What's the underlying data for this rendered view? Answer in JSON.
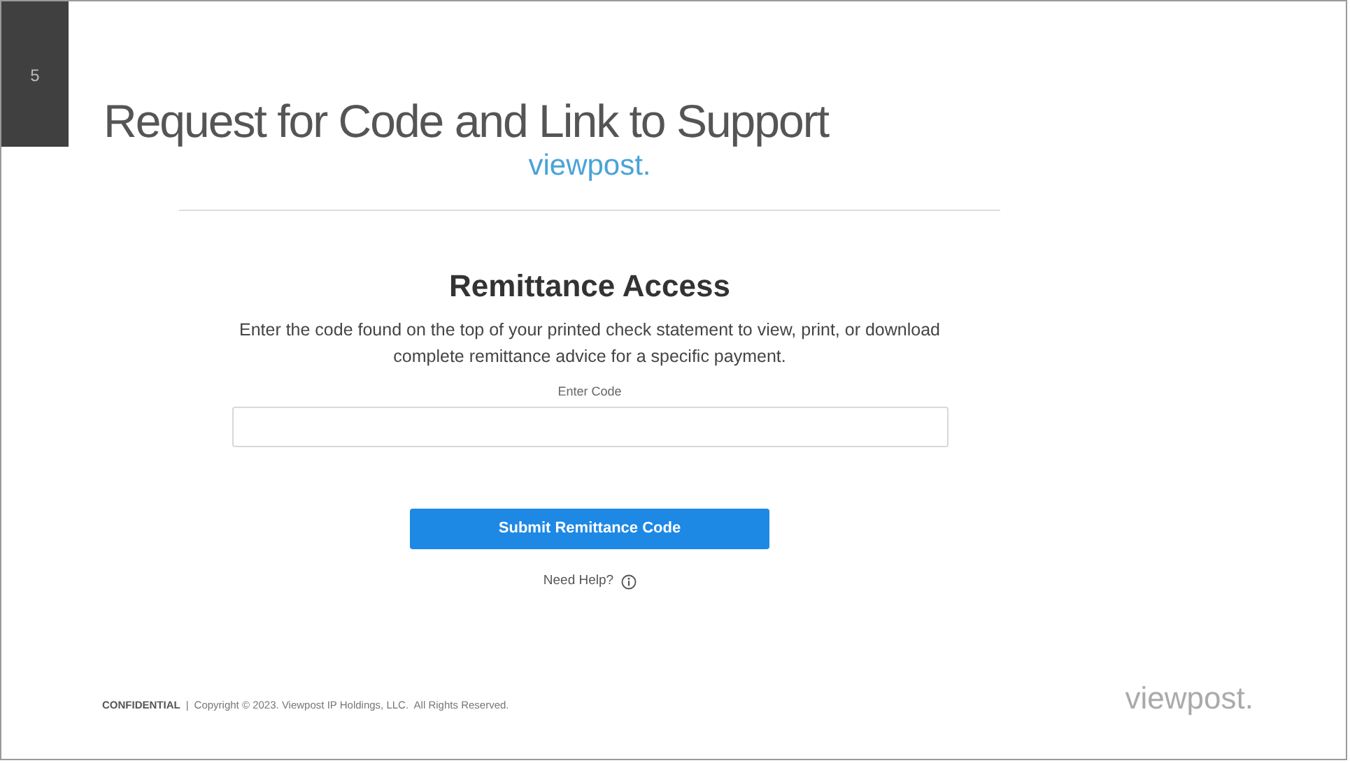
{
  "slide": {
    "number": "5",
    "title": "Request for Code and Link to Support"
  },
  "web_page": {
    "logo": "viewpost.",
    "heading": "Remittance Access",
    "description": "Enter the code found on the top of your printed check statement to view, print, or download complete remittance advice for a specific payment.",
    "code_field": {
      "label": "Enter Code"
    },
    "submit_button": "Submit Remittance Code",
    "help_link": "Need Help?"
  },
  "footer": {
    "confidential": "CONFIDENTIAL",
    "separator": "|",
    "copyright": "Copyright © 2023. Viewpost IP Holdings, LLC.  All Rights Reserved.",
    "logo": "viewpost."
  }
}
